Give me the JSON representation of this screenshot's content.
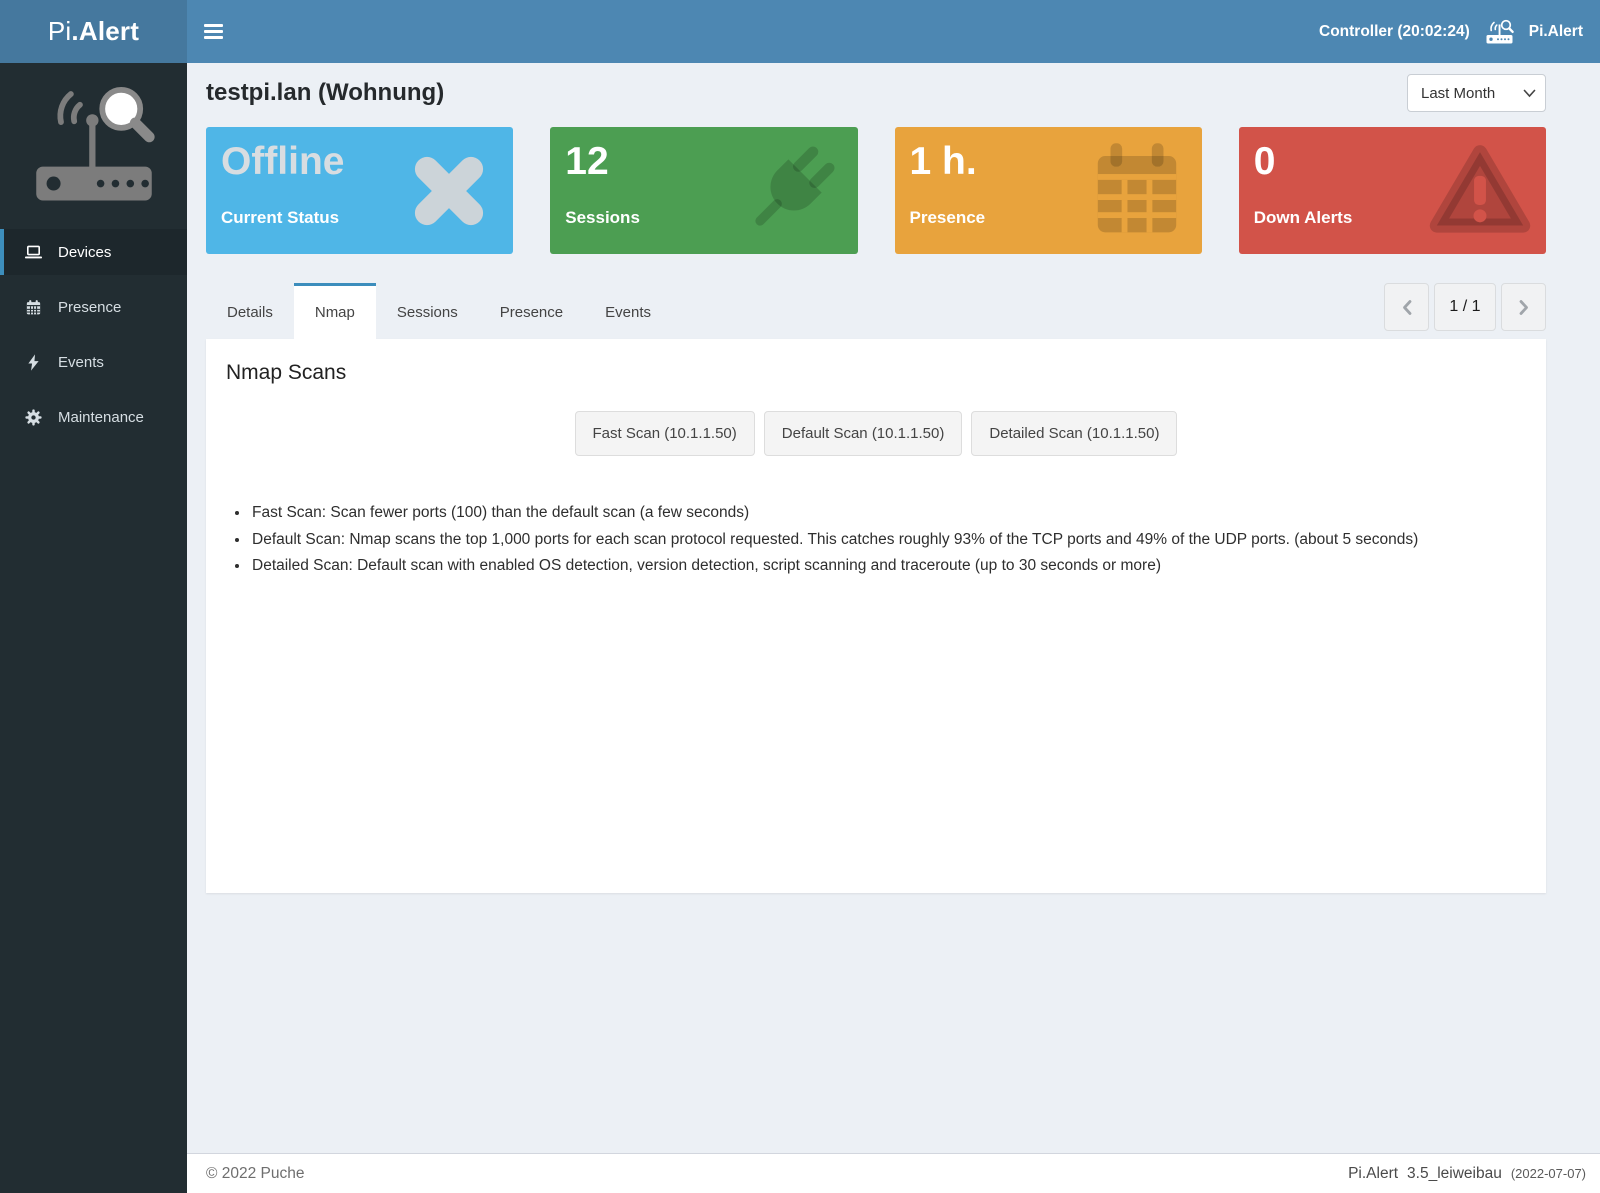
{
  "navbar": {
    "logo_thin": "Pi",
    "logo_bold": ".Alert",
    "controller": "Controller (20:02:24)",
    "brand": "Pi.Alert"
  },
  "sidebar": {
    "items": [
      {
        "label": "Devices",
        "icon": "laptop-icon",
        "active": true
      },
      {
        "label": "Presence",
        "icon": "calendar-icon",
        "active": false
      },
      {
        "label": "Events",
        "icon": "bolt-icon",
        "active": false
      },
      {
        "label": "Maintenance",
        "icon": "gear-icon",
        "active": false
      }
    ]
  },
  "page": {
    "title": "testpi.lan (Wohnung)",
    "period_select": {
      "value": "Last Month"
    }
  },
  "cards": [
    {
      "value": "Offline",
      "label": "Current Status",
      "icon": "xmark-icon",
      "color": "#4fb6e7"
    },
    {
      "value": "12",
      "label": "Sessions",
      "icon": "plug-icon",
      "color": "#4c9e52"
    },
    {
      "value": "1 h.",
      "label": "Presence",
      "icon": "calendar-icon",
      "color": "#e8a33d"
    },
    {
      "value": "0",
      "label": "Down Alerts",
      "icon": "warning-icon",
      "color": "#d25349"
    }
  ],
  "tabs": {
    "items": [
      "Details",
      "Nmap",
      "Sessions",
      "Presence",
      "Events"
    ],
    "active": "Nmap"
  },
  "pagination": {
    "current": "1 / 1"
  },
  "panel": {
    "heading": "Nmap Scans",
    "buttons": [
      "Fast Scan (10.1.1.50)",
      "Default Scan (10.1.1.50)",
      "Detailed Scan (10.1.1.50)"
    ],
    "notes": [
      "Fast Scan: Scan fewer ports (100) than the default scan (a few seconds)",
      "Default Scan: Nmap scans the top 1,000 ports for each scan protocol requested. This catches roughly 93% of the TCP ports and 49% of the UDP ports. (about 5 seconds)",
      "Detailed Scan: Default scan with enabled OS detection, version detection, script scanning and traceroute (up to 30 seconds or more)"
    ]
  },
  "footer": {
    "left": "© 2022 Puche",
    "right_name": "Pi.Alert",
    "right_version": "3.5_leiweibau",
    "right_date": "(2022-07-07)"
  }
}
